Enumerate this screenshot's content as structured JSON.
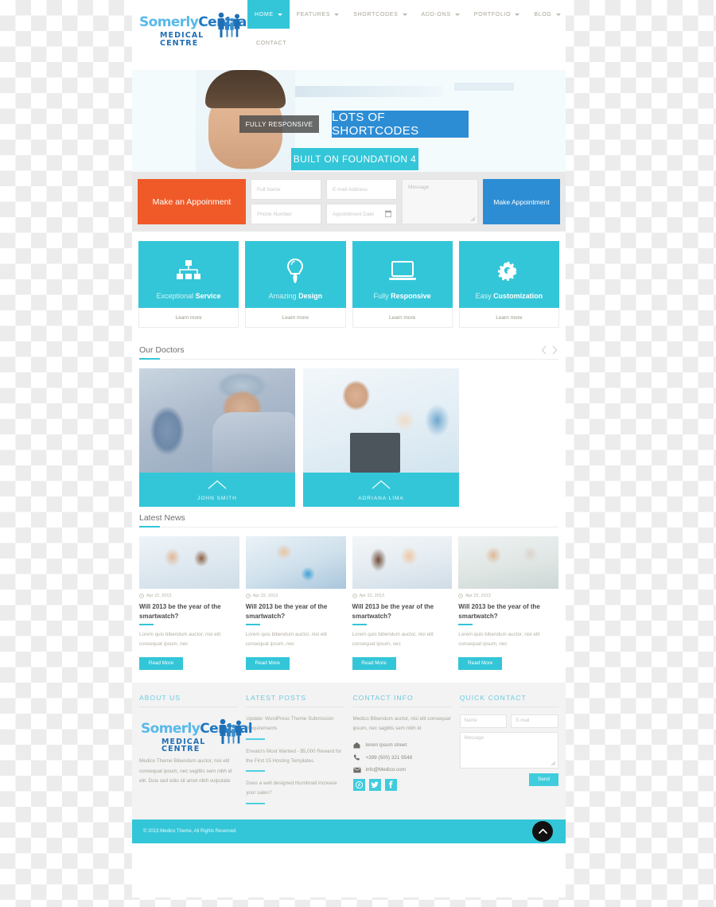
{
  "brand": {
    "name_part1": "Somerly",
    "name_part2": "Central",
    "subtitle": "MEDICAL  CENTRE",
    "logo_icon": "family-figures-icon"
  },
  "nav": {
    "items": [
      {
        "label": "HOME",
        "has_caret": true,
        "active": true
      },
      {
        "label": "FEATURES",
        "has_caret": true,
        "active": false
      },
      {
        "label": "SHORTCODES",
        "has_caret": true,
        "active": false
      },
      {
        "label": "ADD-ONS",
        "has_caret": true,
        "active": false
      },
      {
        "label": "PORTFOLIO",
        "has_caret": true,
        "active": false
      },
      {
        "label": "BLOG",
        "has_caret": true,
        "active": false
      }
    ],
    "second_row": [
      {
        "label": "CONTACT",
        "has_caret": false,
        "active": false
      }
    ]
  },
  "hero": {
    "badge_responsive": "FULLY RESPONSIVE",
    "badge_shortcodes": "LOTS OF SHORTCODES",
    "badge_foundation": "BUILT ON FOUNDATION 4"
  },
  "appointment": {
    "title": "Make an Appoinment",
    "fields": [
      {
        "placeholder": "Full Name",
        "value": ""
      },
      {
        "placeholder": "E-mail Address",
        "value": ""
      },
      {
        "placeholder": "Phone Number",
        "value": ""
      },
      {
        "placeholder": "Appointment Date",
        "value": "",
        "icon": "calendar-icon"
      }
    ],
    "message_placeholder": "Message",
    "submit_label": "Make Appointment"
  },
  "features": [
    {
      "title_light": "Exceptional ",
      "title_bold": "Service",
      "icon": "sitemap-icon",
      "link": "Learn more"
    },
    {
      "title_light": "Amazing ",
      "title_bold": "Design",
      "icon": "lightbulb-icon",
      "link": "Learn more"
    },
    {
      "title_light": "Fully ",
      "title_bold": "Responsive",
      "icon": "laptop-icon",
      "link": "Learn more"
    },
    {
      "title_light": "Easy ",
      "title_bold": "Customization",
      "icon": "gears-icon",
      "link": "Learn more"
    }
  ],
  "doctors": {
    "section_title": "Our Doctors",
    "prev_icon": "chevron-left-icon",
    "next_icon": "chevron-right-icon",
    "items": [
      {
        "name": "JOHN SMITH",
        "image": "surgeon-in-operating-room-photo"
      },
      {
        "name": "ADRIANA LIMA",
        "image": "doctor-with-clipboard-and-team-photo"
      }
    ]
  },
  "news": {
    "section_title": "Latest News",
    "items": [
      {
        "date": "Apr 22, 2013",
        "title": "Will 2013 be the year of the smartwatch?",
        "excerpt": "Lorem quis bibendum auctor, nisi elit consequat ipsum, nec",
        "button": "Read More",
        "image": "two-doctors-smiling-photo"
      },
      {
        "date": "Apr 22, 2013",
        "title": "Will 2013 be the year of the smartwatch?",
        "excerpt": "Lorem quis bibendum auctor, nisi elit consequat ipsum, nec",
        "button": "Read More",
        "image": "scientist-in-lab-photo"
      },
      {
        "date": "Apr 22, 2013",
        "title": "Will 2013 be the year of the smartwatch?",
        "excerpt": "Lorem quis bibendum auctor, nisi elit consequat ipsum, nec",
        "button": "Read More",
        "image": "doctor-with-child-photo"
      },
      {
        "date": "Apr 22, 2013",
        "title": "Will 2013 be the year of the smartwatch?",
        "excerpt": "Lorem quis bibendum auctor, nisi elit consequat ipsum, nec",
        "button": "Read More",
        "image": "doctor-with-elderly-patient-photo"
      }
    ]
  },
  "footer": {
    "about": {
      "title": "ABOUT US",
      "text": "Medico Theme Bibendum auctor, nisi elit consequat ipsum, nec sagittis sem nibh id elit. Duis sed odio sit amet nibh vulputate"
    },
    "latest_posts": {
      "title": "LATEST POSTS",
      "items": [
        "Update: WordPress Theme Submission Requirements",
        "Envato's Most Wanted - $5,000 Reward for the First 15 Hosting Templates",
        "Does a well designed thumbnail increase your sales?"
      ]
    },
    "contact_info": {
      "title": "CONTACT INFO",
      "text": "Medico Bibendum auctor, nisi elit consequat ipsum, nec sagittis sem nibh id",
      "address": "lorem ipsum street",
      "address_icon": "home-icon",
      "phone": "+399 (500) 321 9548",
      "phone_icon": "phone-icon",
      "email": "info@Medico.com",
      "email_icon": "envelope-icon",
      "socials": [
        {
          "name": "pinterest-icon",
          "glyph": "P"
        },
        {
          "name": "twitter-icon",
          "glyph": "t"
        },
        {
          "name": "facebook-icon",
          "glyph": "f"
        }
      ]
    },
    "quick_contact": {
      "title": "QUICK CONTACT",
      "name_placeholder": "Name",
      "email_placeholder": "E-mail",
      "message_placeholder": "Message",
      "send_label": "Send"
    }
  },
  "copyright": {
    "text": "© 2013 Medico Theme, All Rights Reserved.",
    "to_top_icon": "chevron-up-icon"
  },
  "colors": {
    "teal": "#33c6d8",
    "orange": "#f05a28",
    "blue": "#2d8dd4",
    "logo_light_blue": "#58b9ea",
    "logo_dark_blue": "#1f78c1"
  }
}
